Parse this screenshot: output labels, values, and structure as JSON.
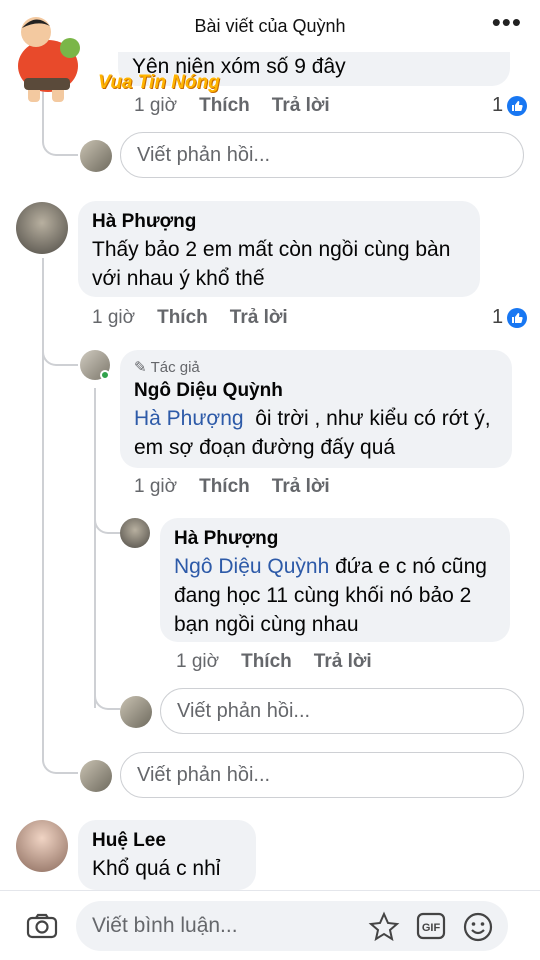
{
  "header": {
    "title": "Bài viết của Quỳnh"
  },
  "watermark": {
    "text": "Vua Tin Nóng"
  },
  "comments": {
    "c0": {
      "text_partial": "Yên niên xóm số 9 đây",
      "time": "1 giờ",
      "like": "Thích",
      "reply": "Trả lời",
      "like_count": "1"
    },
    "reply_box_1": {
      "placeholder": "Viết phản hồi..."
    },
    "c1": {
      "name": "Hà Phượng",
      "text": "Thấy bảo 2 em mất còn ngồi cùng bàn với nhau ý khổ thế",
      "time": "1 giờ",
      "like": "Thích",
      "reply": "Trả lời",
      "like_count": "1"
    },
    "c1r1": {
      "author_tag": "Tác giả",
      "name": "Ngô Diệu Quỳnh",
      "mention": "Hà Phượng",
      "text": "ôi trời , như kiểu có rớt ý, em sợ đoạn đường đấy quá",
      "time": "1 giờ",
      "like": "Thích",
      "reply": "Trả lời"
    },
    "c1r2": {
      "name": "Hà Phượng",
      "mention": "Ngô Diệu Quỳnh",
      "text": "đứa e c nó cũng đang học 11 cùng khối nó bảo 2 bạn ngồi cùng nhau",
      "time": "1 giờ",
      "like": "Thích",
      "reply": "Trả lời"
    },
    "reply_box_2": {
      "placeholder": "Viết phản hồi..."
    },
    "reply_box_3": {
      "placeholder": "Viết phản hồi..."
    },
    "c2": {
      "name": "Huệ Lee",
      "text": "Khổ quá c nhỉ"
    }
  },
  "compose": {
    "placeholder": "Viết bình luận..."
  },
  "colors": {
    "like_blue": "#1877f2",
    "mention": "#2d5aa8",
    "bubble": "#f0f2f5",
    "watermark": "#ffb400"
  }
}
